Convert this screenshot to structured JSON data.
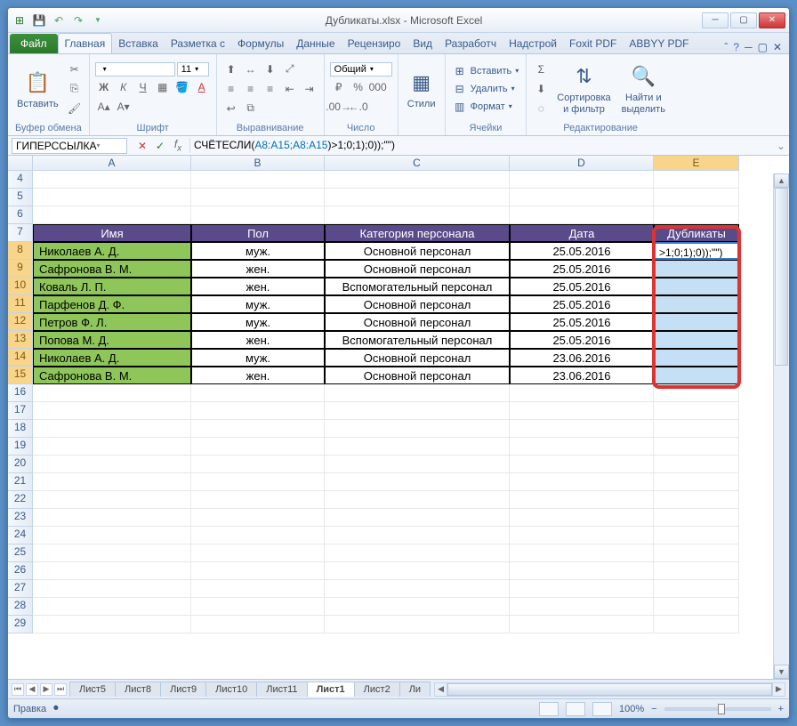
{
  "window": {
    "title": "Дубликаты.xlsx - Microsoft Excel"
  },
  "ribbon": {
    "file": "Файл",
    "tabs": [
      "Главная",
      "Вставка",
      "Разметка с",
      "Формулы",
      "Данные",
      "Рецензиро",
      "Вид",
      "Разработч",
      "Надстрой",
      "Foxit PDF",
      "ABBYY PDF"
    ],
    "active": 0
  },
  "groups": {
    "clipboard": {
      "paste": "Вставить",
      "label": "Буфер обмена"
    },
    "font": {
      "name": "",
      "size": "11",
      "label": "Шрифт"
    },
    "align": {
      "label": "Выравнивание"
    },
    "number": {
      "format": "Общий",
      "label": "Число"
    },
    "styles": {
      "btn": "Стили"
    },
    "cells": {
      "insert": "Вставить",
      "delete": "Удалить",
      "format": "Формат",
      "label": "Ячейки"
    },
    "editing": {
      "sort": "Сортировка\nи фильтр",
      "find": "Найти и\nвыделить",
      "label": "Редактирование"
    }
  },
  "fbar": {
    "name": "ГИПЕРССЫЛКА",
    "formula_prefix": "СЧЁТЕСЛИ(",
    "formula_range": "A8:A15;A8:A15",
    "formula_suffix": ")>1;0;1);0));\"\")"
  },
  "columns": [
    "A",
    "B",
    "C",
    "D",
    "E"
  ],
  "visible_rows_before": [
    4,
    5,
    6
  ],
  "header_row": 7,
  "headers": {
    "A": "Имя",
    "B": "Пол",
    "C": "Категория персонала",
    "D": "Дата",
    "E": "Дубликаты"
  },
  "rows": [
    {
      "n": 8,
      "A": "Николаев А. Д.",
      "B": "муж.",
      "C": "Основной персонал",
      "D": "25.05.2016",
      "E": ">1;0;1);0));\"\")"
    },
    {
      "n": 9,
      "A": "Сафронова В. М.",
      "B": "жен.",
      "C": "Основной персонал",
      "D": "25.05.2016",
      "E": ""
    },
    {
      "n": 10,
      "A": "Коваль Л. П.",
      "B": "жен.",
      "C": "Вспомогательный персонал",
      "D": "25.05.2016",
      "E": ""
    },
    {
      "n": 11,
      "A": "Парфенов Д. Ф.",
      "B": "муж.",
      "C": "Основной персонал",
      "D": "25.05.2016",
      "E": ""
    },
    {
      "n": 12,
      "A": "Петров Ф. Л.",
      "B": "муж.",
      "C": "Основной персонал",
      "D": "25.05.2016",
      "E": ""
    },
    {
      "n": 13,
      "A": "Попова М. Д.",
      "B": "жен.",
      "C": "Вспомогательный персонал",
      "D": "25.05.2016",
      "E": ""
    },
    {
      "n": 14,
      "A": "Николаев А. Д.",
      "B": "муж.",
      "C": "Основной персонал",
      "D": "23.06.2016",
      "E": ""
    },
    {
      "n": 15,
      "A": "Сафронова В. М.",
      "B": "жен.",
      "C": "Основной персонал",
      "D": "23.06.2016",
      "E": ""
    }
  ],
  "visible_rows_after": [
    16,
    17,
    18,
    19,
    20,
    21,
    22,
    23,
    24,
    25,
    26,
    27,
    28,
    29
  ],
  "sheets": {
    "list": [
      "Лист5",
      "Лист8",
      "Лист9",
      "Лист10",
      "Лист11",
      "Лист1",
      "Лист2",
      "Ли"
    ],
    "active": 5
  },
  "status": {
    "mode": "Правка",
    "zoom": "100%"
  }
}
